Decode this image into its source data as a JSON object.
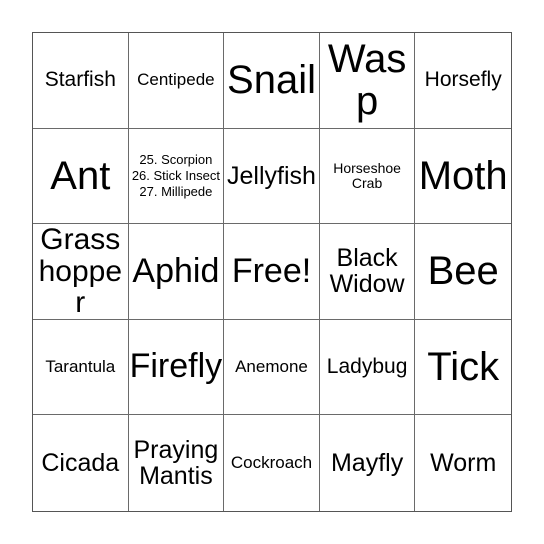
{
  "card": {
    "type": "bingo-card",
    "columns": 5,
    "rows": 5,
    "background_color": "#ffffff",
    "border_color": "#555555",
    "grid_line_color": "#6a6a6a",
    "text_color": "#000000",
    "cells": [
      {
        "text": "Starfish",
        "size": "sm"
      },
      {
        "text": "Centipede",
        "size": "xs"
      },
      {
        "text": "Snail",
        "size": "xxl"
      },
      {
        "text": "Wasp",
        "size": "xxl"
      },
      {
        "text": "Horsefly",
        "size": "sm"
      },
      {
        "text": "Ant",
        "size": "xxl"
      },
      {
        "text": "25. Scorpion 26. Stick Insect 27. Millipede",
        "size": "tiny"
      },
      {
        "text": "Jellyfish",
        "size": "md"
      },
      {
        "text": "Horseshoe Crab",
        "size": "xxs"
      },
      {
        "text": "Moth",
        "size": "xxl"
      },
      {
        "text": "Grasshopper",
        "size": "lg"
      },
      {
        "text": "Aphid",
        "size": "xl"
      },
      {
        "text": "Free!",
        "size": "xl"
      },
      {
        "text": "Black Widow",
        "size": "md"
      },
      {
        "text": "Bee",
        "size": "xxl"
      },
      {
        "text": "Tarantula",
        "size": "xs"
      },
      {
        "text": "Firefly",
        "size": "xl"
      },
      {
        "text": "Anemone",
        "size": "xs"
      },
      {
        "text": "Ladybug",
        "size": "sm"
      },
      {
        "text": "Tick",
        "size": "xxl"
      },
      {
        "text": "Cicada",
        "size": "md"
      },
      {
        "text": "Praying Mantis",
        "size": "md"
      },
      {
        "text": "Cockroach",
        "size": "xs"
      },
      {
        "text": "Mayfly",
        "size": "md"
      },
      {
        "text": "Worm",
        "size": "md"
      }
    ]
  }
}
